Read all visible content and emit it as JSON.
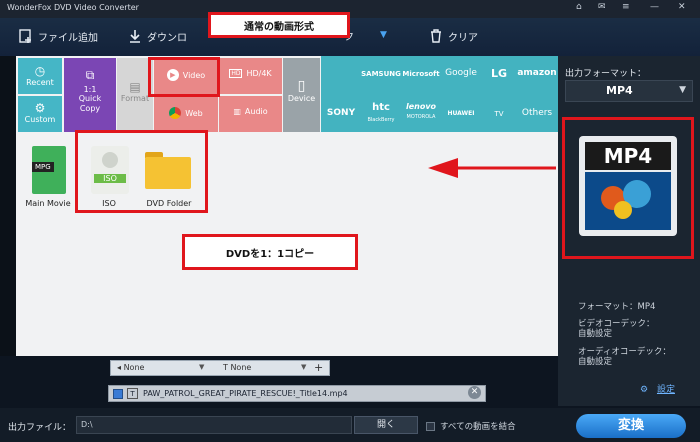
{
  "app": {
    "title": "WonderFox DVD Video Converter"
  },
  "window_controls": [
    "⌂",
    "✉",
    "≡",
    "—",
    "✕"
  ],
  "toolbar": {
    "add_file": "ファイル追加",
    "download": "ダウンロ",
    "clip": "ク",
    "clear": "クリア"
  },
  "categories": {
    "recent": "Recent",
    "custom": "Custom",
    "copy_ratio": "1:1",
    "quick_copy": "Quick\nCopy",
    "format": "Format",
    "video": "Video",
    "hd": "HD/4K",
    "web": "Web",
    "audio": "Audio",
    "device": "Device"
  },
  "brands": [
    "SAMSUNG",
    "Microsoft",
    "Google",
    "LG",
    "amazon",
    "SONY",
    "htc",
    "lenovo",
    "HUAWEI",
    "TV",
    "Others"
  ],
  "brand_sub": {
    "htc": "BlackBerry",
    "lenovo": "MOTOROLA"
  },
  "tiles": {
    "main_movie": "Main Movie",
    "mpg": "MPG",
    "iso": "ISO",
    "iso_badge": "ISO",
    "dvd_folder": "DVD Folder"
  },
  "callouts": {
    "top": "通常の動画形式",
    "middle": "DVDを1：1コピー"
  },
  "right_panel": {
    "output_format_label": "出力フォーマット：",
    "output_format_value": "MP4",
    "thumb_text": "MP4",
    "format_info": "フォーマット：MP4",
    "video_codec_label": "ビデオコーデック：",
    "video_codec_value": "自動設定",
    "audio_codec_label": "オーディオコーデック：",
    "audio_codec_value": "自動設定",
    "settings_link": "設定"
  },
  "selectors": {
    "subtitle": "None",
    "audio": "None"
  },
  "video_item": {
    "name": "PAW_PATROL_GREAT_PIRATE_RESCUE!_Title14.mp4"
  },
  "bottom": {
    "output_file_label": "出力ファイル：",
    "output_path": "D:\\",
    "open_button": "開く",
    "merge_label": "すべての動画を結合",
    "convert_button": "変換"
  },
  "colors": {
    "accent_red": "#e0161c",
    "recent_tile": "#45b6c6",
    "quick_copy_tile": "#7b46b4",
    "format_tile": "#d6d6d6",
    "video_tile": "#e98888",
    "device_tile": "#9aa3a8",
    "brand_bar": "#43b3c0",
    "convert_button": "#2a89e0"
  }
}
